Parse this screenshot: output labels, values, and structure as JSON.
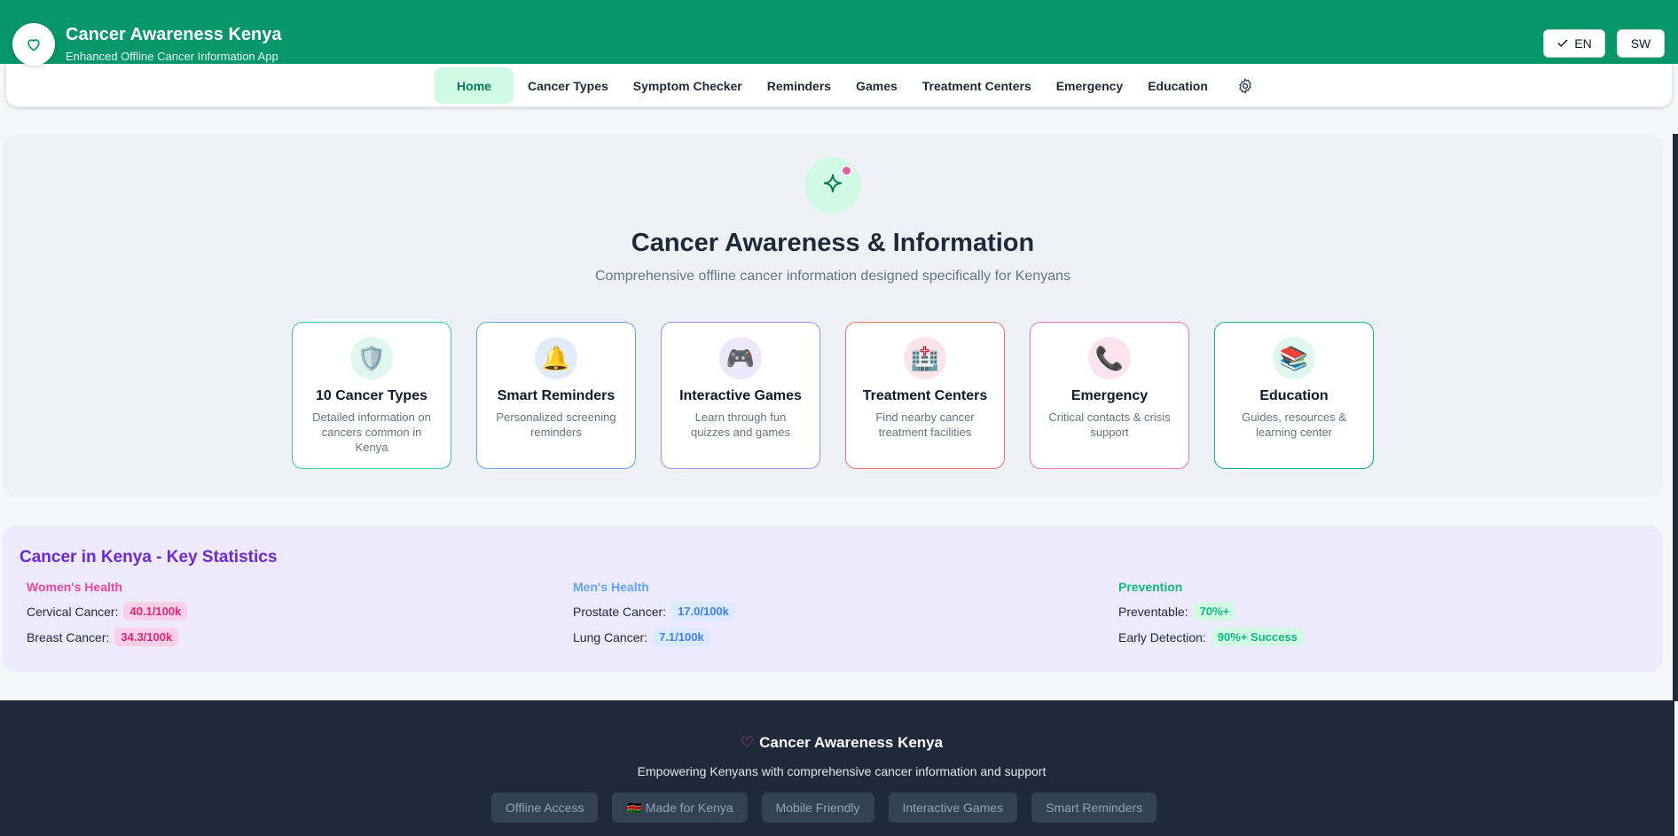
{
  "app": {
    "title": "Cancer Awareness Kenya",
    "subtitle": "Enhanced Offline Cancer Information App",
    "logo_icon": "heart-icon",
    "brand_color": "#059669"
  },
  "language": {
    "en_label": "EN",
    "sw_label": "SW",
    "selected": "EN"
  },
  "nav": {
    "items": [
      {
        "label": "Home",
        "active": true
      },
      {
        "label": "Cancer Types"
      },
      {
        "label": "Symptom Checker"
      },
      {
        "label": "Reminders"
      },
      {
        "label": "Games"
      },
      {
        "label": "Treatment Centers"
      },
      {
        "label": "Emergency"
      },
      {
        "label": "Education"
      }
    ],
    "settings_icon": "gear-icon"
  },
  "hero": {
    "icon": "sparkle-icon",
    "title": "Cancer Awareness & Information",
    "subtitle": "Comprehensive offline cancer information designed specifically for Kenyans",
    "cards": [
      {
        "title": "10 Cancer Types",
        "desc": "Detailed information on cancers common in Kenya",
        "icon": "shield-icon",
        "glyph": "🛡️",
        "border": "#34d399",
        "bg": "#dff7ee"
      },
      {
        "title": "Smart Reminders",
        "desc": "Personalized screening reminders",
        "icon": "bell-icon",
        "glyph": "🔔",
        "border": "#60a5fa",
        "bg": "#e0ecfb"
      },
      {
        "title": "Interactive Games",
        "desc": "Learn through fun quizzes and games",
        "icon": "gamepad-icon",
        "glyph": "🎮",
        "border": "#a78bfa",
        "bg": "#ede7fb"
      },
      {
        "title": "Treatment Centers",
        "desc": "Find nearby cancer treatment facilities",
        "icon": "hospital-icon",
        "glyph": "🏥",
        "border": "#f87171",
        "bg": "#fce4e8"
      },
      {
        "title": "Emergency",
        "desc": "Critical contacts & crisis support",
        "icon": "phone-icon",
        "glyph": "📞",
        "border": "#f472b6",
        "bg": "#fce4ef"
      },
      {
        "title": "Education",
        "desc": "Guides, resources & learning center",
        "icon": "books-icon",
        "glyph": "📚",
        "border": "#10b981",
        "bg": "#dff7ee"
      }
    ]
  },
  "stats": {
    "title": "Cancer in Kenya - Key Statistics",
    "columns": [
      {
        "heading": "Women's Health",
        "color": "#ec4899",
        "rows": [
          {
            "label": "Cervical Cancer:",
            "value": "40.1/100k"
          },
          {
            "label": "Breast Cancer:",
            "value": "34.3/100k"
          }
        ]
      },
      {
        "heading": "Men's Health",
        "color": "#60a5fa",
        "rows": [
          {
            "label": "Prostate Cancer:",
            "value": "17.0/100k"
          },
          {
            "label": "Lung Cancer:",
            "value": "7.1/100k"
          }
        ]
      },
      {
        "heading": "Prevention",
        "color": "#10b981",
        "rows": [
          {
            "label": "Preventable:",
            "value": "70%+"
          },
          {
            "label": "Early Detection:",
            "value": "90%+ Success"
          }
        ]
      }
    ]
  },
  "footer": {
    "title": "Cancer Awareness Kenya",
    "tagline": "Empowering Kenyans with comprehensive cancer information and support",
    "tags": [
      "Offline Access",
      "🇰🇪 Made for Kenya",
      "Mobile Friendly",
      "Interactive Games",
      "Smart Reminders"
    ]
  }
}
